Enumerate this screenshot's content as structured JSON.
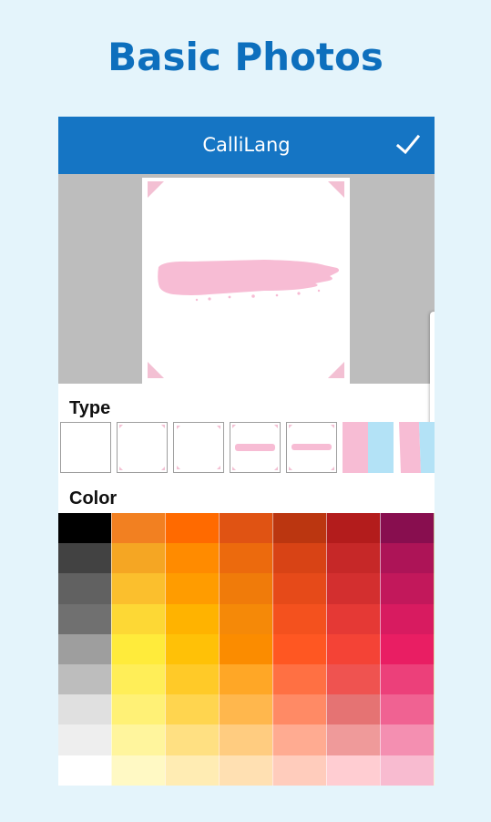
{
  "promo": {
    "title": "Basic Photos"
  },
  "appbar": {
    "title": "CalliLang",
    "confirm_icon": "check-icon"
  },
  "colors": {
    "app_bar": "#1575c4",
    "promo_title": "#0d6fbd",
    "background": "#e4f4fb",
    "preview_background": "#bdbdbd",
    "brush_stroke": "#f7bcd4",
    "corner_marks": "#f3c0d3"
  },
  "editor": {
    "type_label": "Type",
    "color_label": "Color",
    "type_options": [
      "frame-plain",
      "frame-corner-marks",
      "frame-corner-marks-small",
      "brush-stroke-corner-marks",
      "brush-stroke-frame",
      "pink-blue-stripes",
      "pink-blue-stripes-partial"
    ],
    "palette": [
      [
        "#000000",
        "#f28021",
        "#ff6a00",
        "#e05313",
        "#bb3610",
        "#b31c1c",
        "#880e4f",
        "#8e7a1f"
      ],
      [
        "#424242",
        "#f5a623",
        "#ff8b00",
        "#ec6a0d",
        "#d84315",
        "#c62828",
        "#ad1457",
        "#9e8a20"
      ],
      [
        "#616161",
        "#fbbf2d",
        "#ff9c00",
        "#f07b0a",
        "#e64a19",
        "#d32f2f",
        "#c2185b",
        "#aa9624"
      ],
      [
        "#707070",
        "#fdd835",
        "#ffb300",
        "#f58908",
        "#f4511e",
        "#e53935",
        "#d81b60",
        "#b3a12b"
      ],
      [
        "#9e9e9e",
        "#ffeb3b",
        "#ffc107",
        "#fb8c00",
        "#ff5722",
        "#f44336",
        "#e91e63",
        "#c0ae35"
      ],
      [
        "#bdbdbd",
        "#ffee58",
        "#ffca28",
        "#ffa726",
        "#ff7043",
        "#ef5350",
        "#ec407a",
        "#cabb45"
      ],
      [
        "#e0e0e0",
        "#fff176",
        "#ffd54f",
        "#ffb74d",
        "#ff8a65",
        "#e57373",
        "#f06292",
        "#d6c85b"
      ],
      [
        "#eeeeee",
        "#fff59d",
        "#ffe082",
        "#ffcc80",
        "#ffab91",
        "#ef9a9a",
        "#f48fb1",
        "#e0d679"
      ],
      [
        "#ffffff",
        "#fff9c4",
        "#ffecb3",
        "#ffe0b2",
        "#ffccbc",
        "#ffcdd2",
        "#f8bbd0",
        "#ebe3a0"
      ]
    ]
  }
}
